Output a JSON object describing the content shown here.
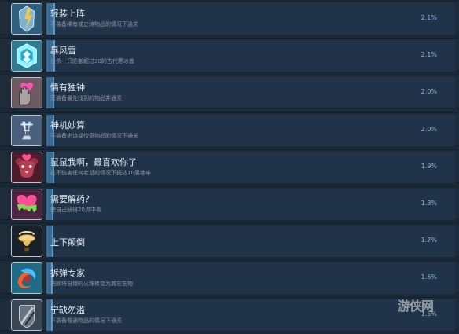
{
  "achievements": [
    {
      "icon": "armor-bolt-icon",
      "title": "轻装上阵",
      "description": "不装备稀有或史诗物品的情况下通关",
      "percent": "2.1%",
      "progress_percent": 2.1,
      "colors": {
        "bg": "#2e5f7f",
        "accent": "#f0c84c"
      }
    },
    {
      "icon": "ice-crystal-icon",
      "title": "暴风雪",
      "description": "击杀一只防御超过30的古代寒冰兽",
      "percent": "2.1%",
      "progress_percent": 2.1,
      "colors": {
        "bg": "#2f7b93",
        "accent": "#c6fbff"
      }
    },
    {
      "icon": "hand-heart-icon",
      "title": "情有独钟",
      "description": "只装备最先找到的物品并通关",
      "percent": "2.0%",
      "progress_percent": 2.0,
      "colors": {
        "bg": "#6e5a63",
        "accent": "#ff4fb0"
      }
    },
    {
      "icon": "trophy-blades-icon",
      "title": "神机妙算",
      "description": "不装备史诗或传奇物品的情况下通关",
      "percent": "2.0%",
      "progress_percent": 2.0,
      "colors": {
        "bg": "#4a5f7b",
        "accent": "#a8c3e6"
      }
    },
    {
      "icon": "rat-heart-icon",
      "title": "鼠鼠我啊，最喜欢你了",
      "description": "在不伤害任何老鼠的情况下抵达10层地牢",
      "percent": "1.9%",
      "progress_percent": 1.9,
      "colors": {
        "bg": "#4c1b2c",
        "accent": "#ff4f93"
      }
    },
    {
      "icon": "slime-heart-icon",
      "title": "需要解药？",
      "description": "使自己获得20点中毒",
      "percent": "1.8%",
      "progress_percent": 1.8,
      "colors": {
        "bg": "#4e2442",
        "accent": "#7cdf52"
      }
    },
    {
      "icon": "upside-down-icon",
      "title": "上下颠倒",
      "description": "",
      "percent": "1.7%",
      "progress_percent": 1.7,
      "colors": {
        "bg": "#18212b",
        "accent": "#e7bf57"
      }
    },
    {
      "icon": "fire-swirl-icon",
      "title": "拆弹专家",
      "description": "把即将自爆的火珠转变为其它生物",
      "percent": "1.6%",
      "progress_percent": 1.6,
      "colors": {
        "bg": "#1f6a85",
        "accent": "#ff5b2a"
      }
    },
    {
      "icon": "shield-slash-icon",
      "title": "宁缺勿滥",
      "description": "不装备普通物品的情况下通关",
      "percent": "1.5%",
      "progress_percent": 1.5,
      "colors": {
        "bg": "#394755",
        "accent": "#c3c9cf"
      }
    }
  ],
  "watermark": "游侠网"
}
